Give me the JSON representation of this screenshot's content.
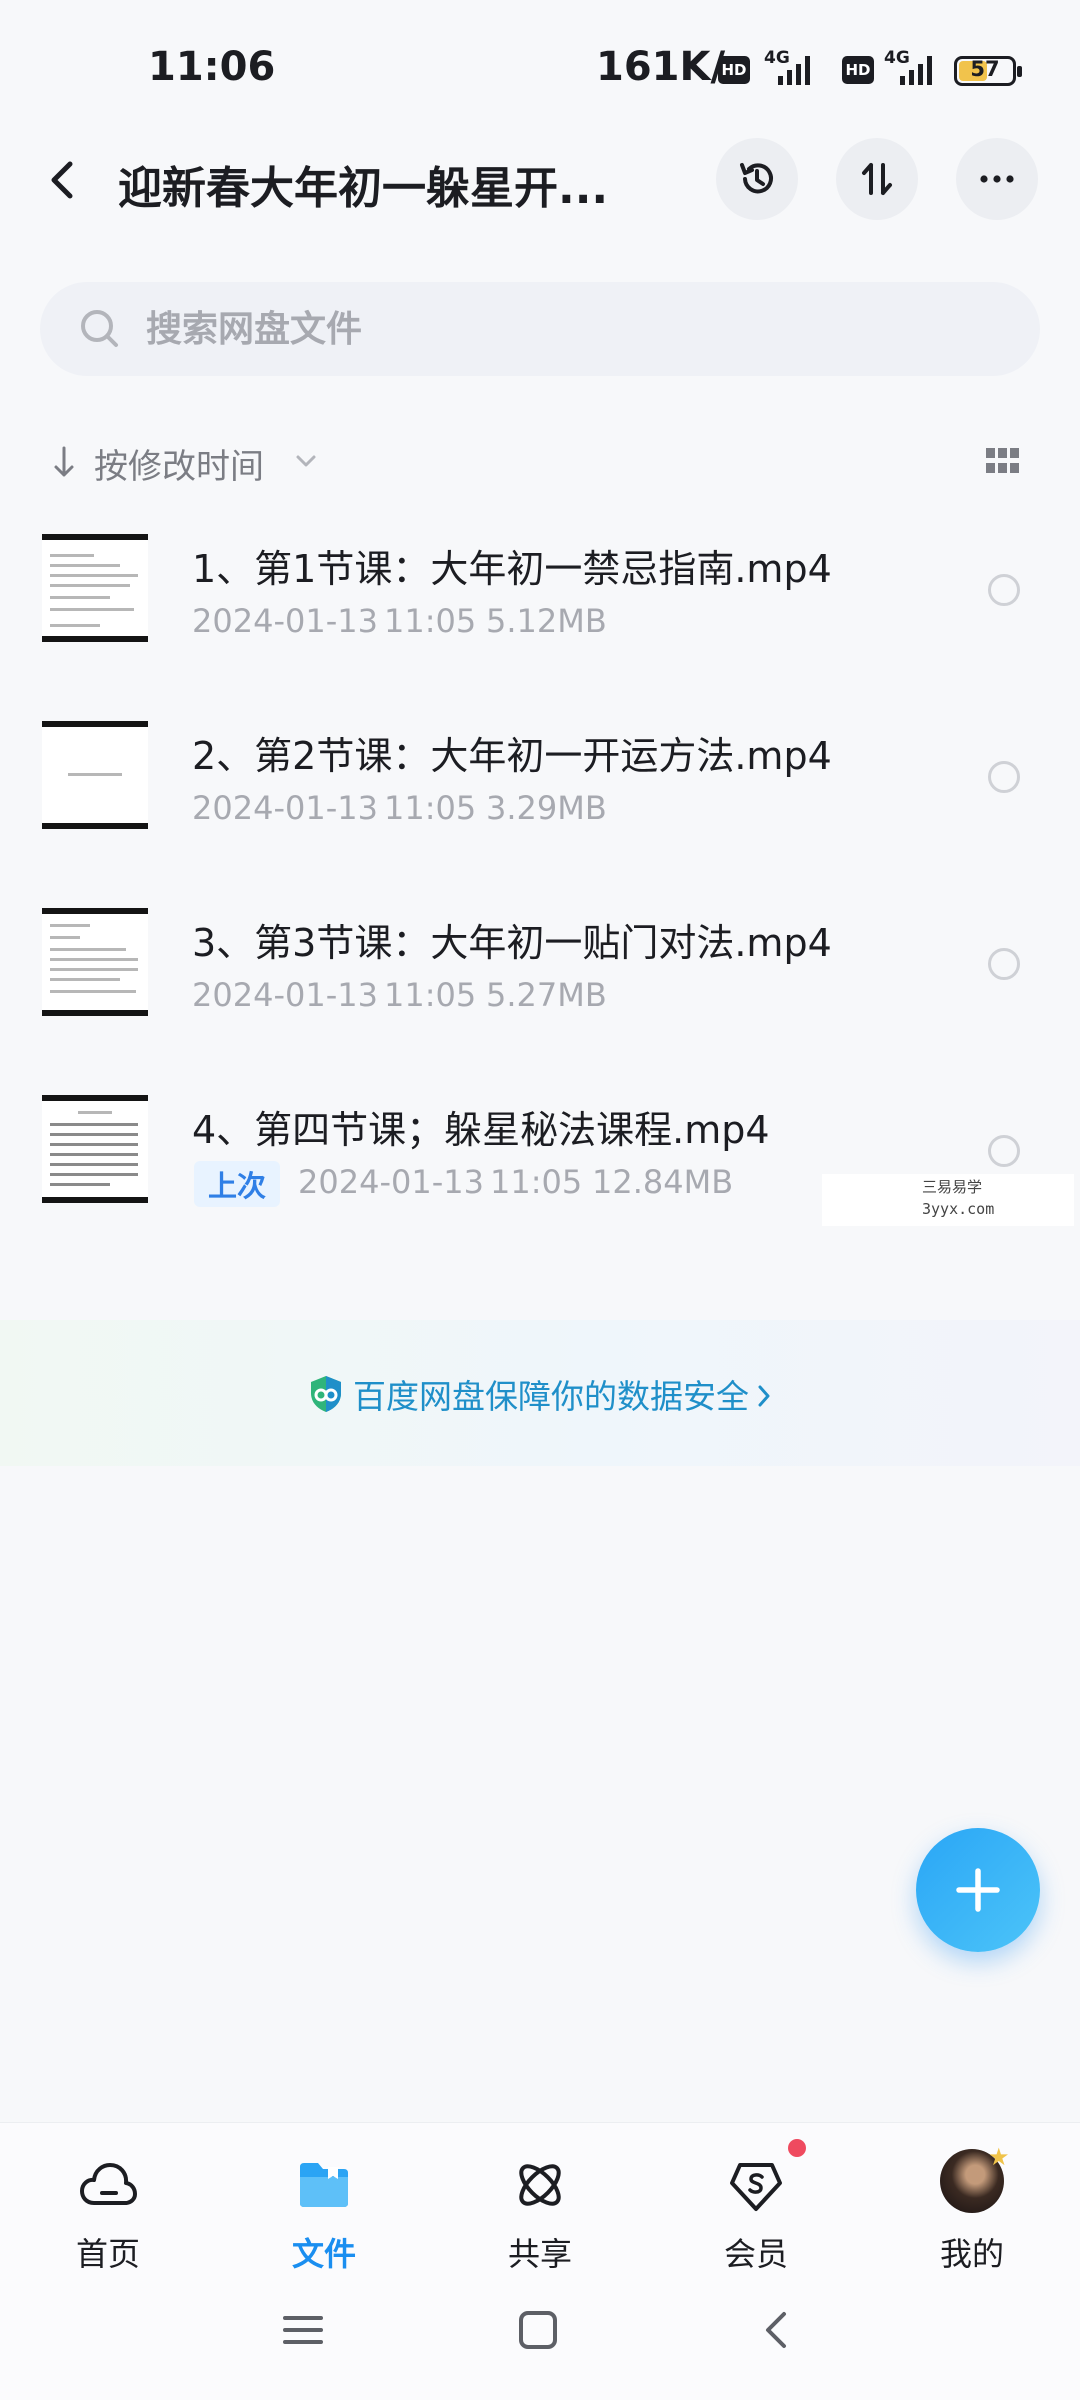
{
  "status_bar": {
    "time": "11:06",
    "net_speed": "161K/s",
    "hd": "HD",
    "network": "4G",
    "battery": "57",
    "battery_level": 0.57
  },
  "header": {
    "title": "迎新春大年初一躲星开...",
    "back_icon": "chevron-left-icon",
    "history_icon": "history-icon",
    "transfer_icon": "transfer-icon",
    "more_icon": "more-icon"
  },
  "search": {
    "placeholder": "搜索网盘文件",
    "value": ""
  },
  "sort": {
    "label": "按修改时间"
  },
  "files": [
    {
      "name": "1、第1节课：大年初一禁忌指南.mp4",
      "date": "2024-01-13",
      "time": "11:05",
      "size": "5.12MB"
    },
    {
      "name": "2、第2节课：大年初一开运方法.mp4",
      "date": "2024-01-13",
      "time": "11:05",
      "size": "3.29MB"
    },
    {
      "name": "3、第3节课：大年初一贴门对法.mp4",
      "date": "2024-01-13",
      "time": "11:05",
      "size": "5.27MB"
    },
    {
      "name": "4、第四节课；躲星秘法课程.mp4",
      "tag": "上次",
      "date": "2024-01-13",
      "time": "11:05",
      "size": "12.84MB"
    }
  ],
  "watermark": {
    "line1": "三易易学",
    "line2": "3yyx.com"
  },
  "security_banner": {
    "text": "百度网盘保障你的数据安全"
  },
  "fab": {
    "icon": "plus-icon"
  },
  "bottom_nav": [
    {
      "label": "首页",
      "icon": "cloud-icon",
      "active": false
    },
    {
      "label": "文件",
      "icon": "folder-icon",
      "active": true
    },
    {
      "label": "共享",
      "icon": "share-icon",
      "active": false
    },
    {
      "label": "会员",
      "icon": "vip-icon",
      "active": false
    },
    {
      "label": "我的",
      "icon": "avatar",
      "active": false
    }
  ],
  "colors": {
    "accent": "#1a8ef0",
    "banner_text": "#1f8fc9",
    "notification_dot": "#ef4a5f",
    "battery": "#f1c34c"
  }
}
